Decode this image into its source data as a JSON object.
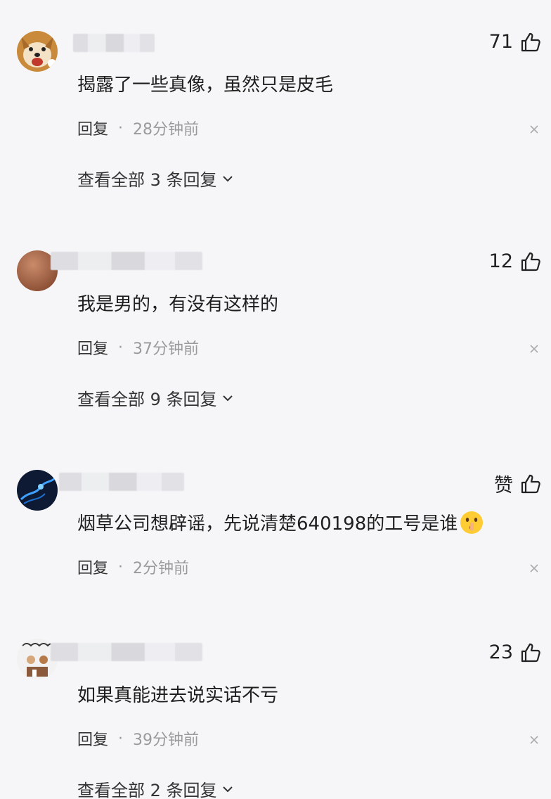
{
  "comments": [
    {
      "likes": "71",
      "text": "揭露了一些真像，虽然只是皮毛",
      "reply_label": "回复",
      "separator": "·",
      "time": "28分钟前",
      "view_replies": "查看全部 3 条回复"
    },
    {
      "likes": "12",
      "text": "我是男的，有没有这样的",
      "reply_label": "回复",
      "separator": "·",
      "time": "37分钟前",
      "view_replies": "查看全部 9 条回复"
    },
    {
      "likes": "赞",
      "text": "烟草公司想辟谣，先说清楚640198的工号是谁",
      "reply_label": "回复",
      "separator": "·",
      "time": "2分钟前"
    },
    {
      "likes": "23",
      "text": "如果真能进去说实话不亏",
      "reply_label": "回复",
      "separator": "·",
      "time": "39分钟前",
      "view_replies": "查看全部 2 条回复"
    }
  ],
  "icons": {
    "like": "thumbs-up-icon",
    "close": "close-icon",
    "expand": "chevron-down-icon",
    "emoji": "shushing-face-emoji"
  },
  "colors": {
    "background": "#f6f6f8",
    "text": "#1e1e1e",
    "muted": "#9a9a9a"
  }
}
